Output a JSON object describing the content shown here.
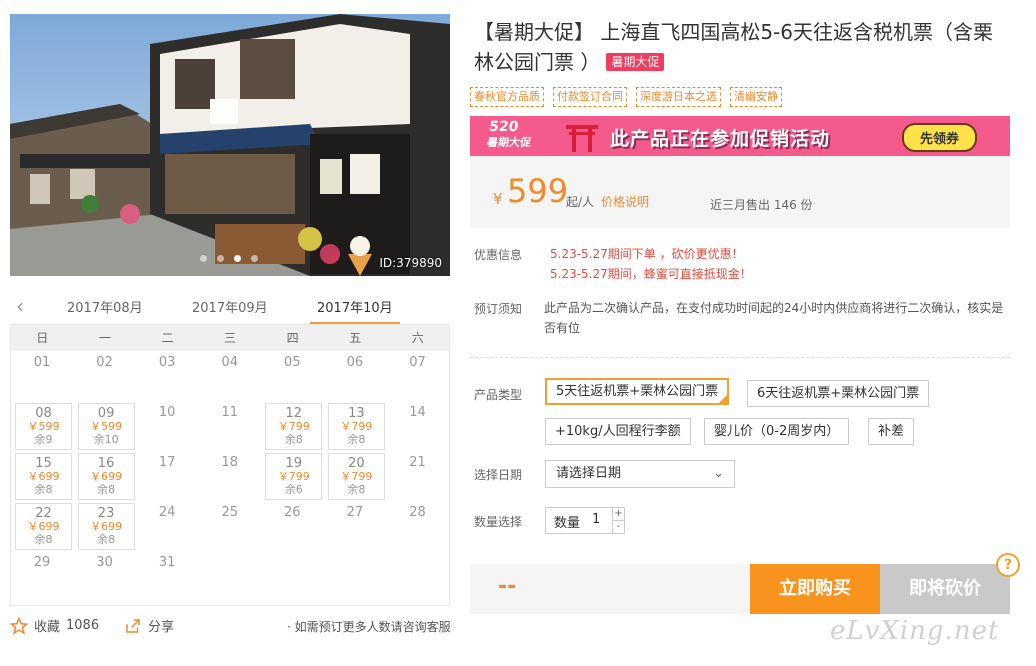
{
  "photo": {
    "id_label": "ID:379890",
    "slide_count": 4,
    "active_slide": 2
  },
  "calendar": {
    "prev_icon": "chevron-left",
    "months": [
      "2017年08月",
      "2017年09月",
      "2017年10月"
    ],
    "active_month": "2017年10月",
    "weekdays": [
      "日",
      "一",
      "二",
      "三",
      "四",
      "五",
      "六"
    ],
    "weeks": [
      [
        {
          "day": "01"
        },
        {
          "day": "02"
        },
        {
          "day": "03"
        },
        {
          "day": "04"
        },
        {
          "day": "05"
        },
        {
          "day": "06"
        },
        {
          "day": "07"
        }
      ],
      [
        {
          "day": "08",
          "price": "￥599",
          "stock": "余9"
        },
        {
          "day": "09",
          "price": "￥599",
          "stock": "余10"
        },
        {
          "day": "10"
        },
        {
          "day": "11"
        },
        {
          "day": "12",
          "price": "￥799",
          "stock": "余8"
        },
        {
          "day": "13",
          "price": "￥799",
          "stock": "余8"
        },
        {
          "day": "14"
        }
      ],
      [
        {
          "day": "15",
          "price": "￥699",
          "stock": "余8"
        },
        {
          "day": "16",
          "price": "￥699",
          "stock": "余8"
        },
        {
          "day": "17"
        },
        {
          "day": "18"
        },
        {
          "day": "19",
          "price": "￥799",
          "stock": "余6"
        },
        {
          "day": "20",
          "price": "￥799",
          "stock": "余8"
        },
        {
          "day": "21"
        }
      ],
      [
        {
          "day": "22",
          "price": "￥699",
          "stock": "余8"
        },
        {
          "day": "23",
          "price": "￥699",
          "stock": "余8"
        },
        {
          "day": "24"
        },
        {
          "day": "25"
        },
        {
          "day": "26"
        },
        {
          "day": "27"
        },
        {
          "day": "28"
        }
      ],
      [
        {
          "day": "29"
        },
        {
          "day": "30"
        },
        {
          "day": "31"
        },
        {
          "day": ""
        },
        {
          "day": ""
        },
        {
          "day": ""
        },
        {
          "day": ""
        }
      ]
    ]
  },
  "actions": {
    "favorite_label": "收藏",
    "favorite_count": "1086",
    "share_label": "分享",
    "consult_text": "· 如需预订更多人数请咨询客服"
  },
  "product": {
    "title": "【暑期大促】 上海直飞四国高松5-6天往返含税机票（含栗林公园门票 ）",
    "title_tag": "暑期大促",
    "features": [
      "春秋官方品质",
      "付款签订合同",
      "深度游日本之选",
      "清幽安静"
    ]
  },
  "banner": {
    "badge_top": "520",
    "badge_bottom": "暑期大促",
    "slogan": "此产品正在参加促销活动",
    "coupon_label": "先领券"
  },
  "price": {
    "currency": "¥",
    "amount": "599",
    "unit": "起/人",
    "explain_link": "价格说明",
    "sold_text": "近三月售出 146 份"
  },
  "promo": {
    "label": "优惠信息",
    "lines": [
      "5.23-5.27期间下单 ，砍价更优惠！",
      "5.23-5.27期间，蜂蜜可直接抵现金！"
    ]
  },
  "notice": {
    "label": "预订须知",
    "text": "此产品为二次确认产品，在支付成功时间起的24小时内供应商将进行二次确认，核实是否有位"
  },
  "options": {
    "type_label": "产品类型",
    "types": [
      "5天往返机票+栗林公园门票",
      "6天往返机票+栗林公园门票",
      "+10kg/人回程行李额",
      "婴儿价（0-2周岁内）",
      "补差"
    ],
    "selected": "5天往返机票+栗林公园门票",
    "date_label": "选择日期",
    "date_placeholder": "请选择日期",
    "qty_label": "数量选择",
    "qty_field_label": "数量",
    "qty_value": "1"
  },
  "checkout": {
    "total": "--",
    "buy_now": "立即购买",
    "coming_soon": "即将砍价",
    "help": "?"
  },
  "watermark": "eLvXing.net",
  "colors": {
    "accent": "#f8941e",
    "promo_red": "#e84a3e",
    "banner_pink": "#f45b8c",
    "tag_red": "#ee3d5f"
  }
}
